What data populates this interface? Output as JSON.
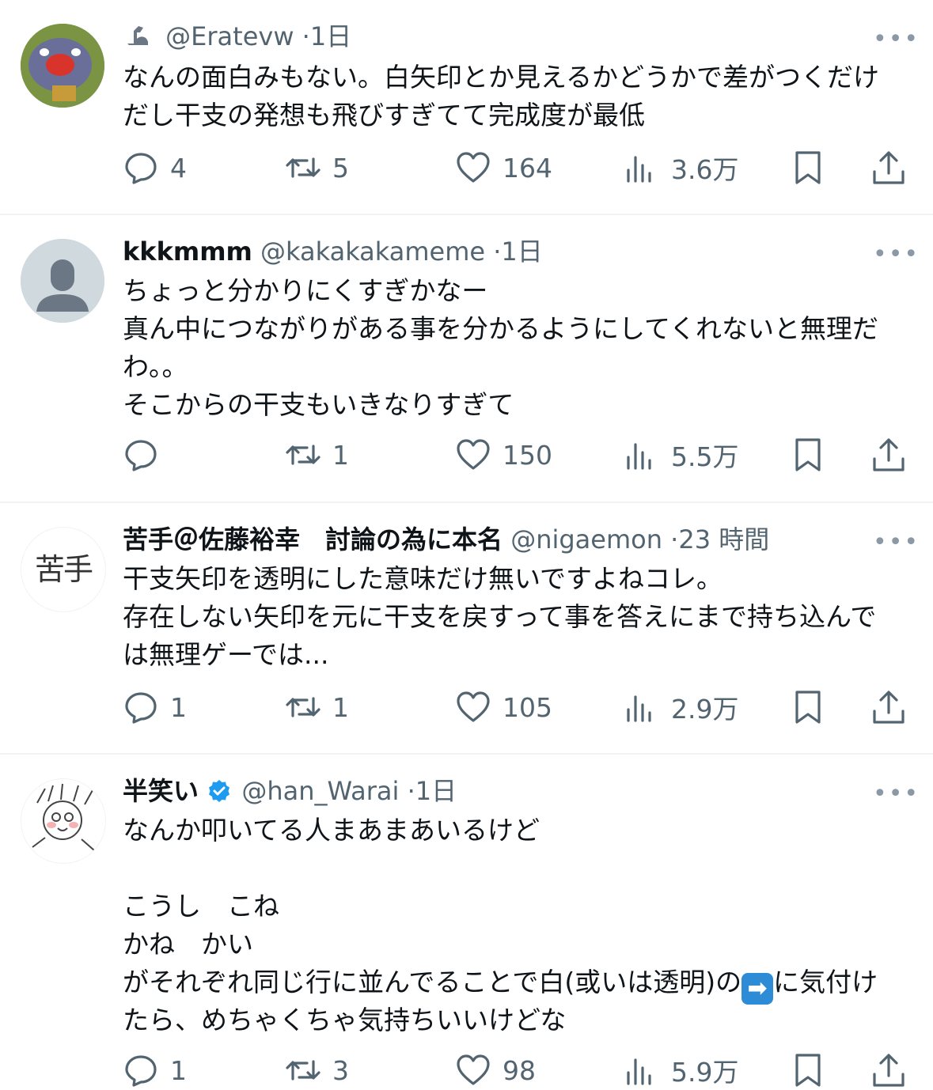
{
  "tweets": [
    {
      "display_name": "",
      "handle": "@Eratevw",
      "time": "1日",
      "lines": [
        "なんの面白みもない。白矢印とか見えるかどうかで差がつくだけ",
        "だし干支の発想も飛びすぎてて完成度が最低"
      ],
      "replies": "4",
      "retweets": "5",
      "likes": "164",
      "views": "3.6万"
    },
    {
      "display_name": "kkkmmm",
      "handle": "@kakakakameme",
      "time": "1日",
      "lines": [
        "ちょっと分かりにくすぎかなー",
        "真ん中につながりがある事を分かるようにしてくれないと無理だ",
        "わ。。",
        "そこからの干支もいきなりすぎて"
      ],
      "replies": "",
      "retweets": "1",
      "likes": "150",
      "views": "5.5万"
    },
    {
      "display_name": "苦手＠佐藤裕幸　討論の為に本名",
      "handle": "@nigaemon",
      "time": "23 時間",
      "avatar_text": "苦手",
      "lines": [
        "干支矢印を透明にした意味だけ無いですよねコレ。",
        "存在しない矢印を元に干支を戻すって事を答えにまで持ち込んで",
        "は無理ゲーでは..."
      ],
      "replies": "1",
      "retweets": "1",
      "likes": "105",
      "views": "2.9万"
    },
    {
      "display_name": "半笑い",
      "handle": "@han_Warai",
      "time": "1日",
      "verified": true,
      "lines": [
        "なんか叩いてる人まあまあいるけど",
        "",
        "こうし　こね",
        "かね　かい",
        "がそれぞれ同じ行に並んでることで白(或いは透明)の",
        "たら、めちゃくちゃ気持ちいいけどな"
      ],
      "line5_emoji": "➡",
      "line5_tail": "に気付け",
      "replies": "1",
      "retweets": "3",
      "likes": "98",
      "views": "5.9万"
    }
  ],
  "header_separator": "·",
  "more_glyph": "•••"
}
